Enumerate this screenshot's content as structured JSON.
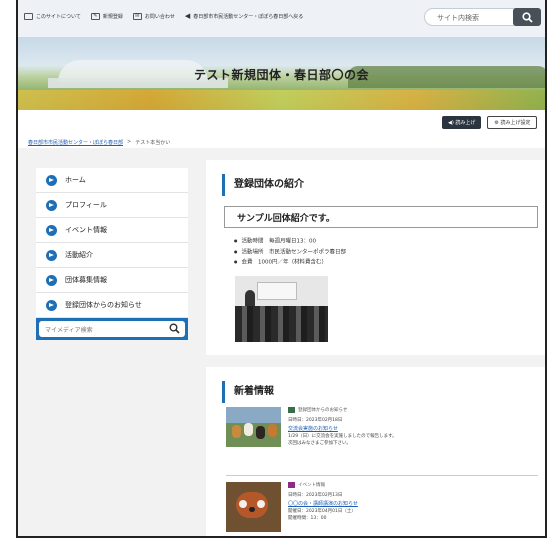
{
  "topbar": {
    "links": [
      {
        "icon": "window-icon",
        "label": "このサイトについて"
      },
      {
        "icon": "edit-icon",
        "label": "新規登録"
      },
      {
        "icon": "mail-icon",
        "label": "お問い合わせ"
      },
      {
        "icon": "back-arrow-icon",
        "label": "春日部市市民活動センター・ぽぽら春日部へ戻る"
      }
    ],
    "search_placeholder": "サイト内検索"
  },
  "hero": {
    "title": "テスト新規団体・春日部〇の会"
  },
  "read_buttons": {
    "read_label": "◀) 読み上げ",
    "settings_label": "⚙ 読み上げ設定"
  },
  "breadcrumb": {
    "home": "春日部市市民活動センター・ぽぽら春日部",
    "separator": ">",
    "current": "テスト本当かい"
  },
  "sidebar": {
    "items": [
      {
        "label": "ホーム"
      },
      {
        "label": "プロフィール"
      },
      {
        "label": "イベント情報"
      },
      {
        "label": "活動紹介"
      },
      {
        "label": "団体募集情報"
      },
      {
        "label": "登録団体からのお知らせ"
      }
    ],
    "search_placeholder": "マイメディア検索"
  },
  "intro_section": {
    "heading": "登録団体の紹介",
    "box_text": "サンプル回体紹介です。",
    "bullets": [
      "活動時間　毎週月曜日13：00",
      "活動場所　市民活動センターポポラ春日部",
      "会費　1000円／年（材料費含む）"
    ]
  },
  "news_section": {
    "heading": "新着情報",
    "items": [
      {
        "tag": "登録団体からのお知らせ",
        "tag_color": "#3a6e4a",
        "date": "日時日：2023年02月18日",
        "title": "交流会実施のお知らせ",
        "body": [
          "1/29（日）に交流会を実施しましたので報告します。",
          "次回はみなさまご参加下さい。"
        ]
      },
      {
        "tag": "イベント情報",
        "tag_color": "#8b2a8b",
        "date": "日時日：2023年02月13日",
        "title": "〇〇の会・講師講演のお知らせ",
        "body": [
          "開催日：2023年04月01日（土）",
          "開催時間：13：00"
        ]
      }
    ]
  }
}
